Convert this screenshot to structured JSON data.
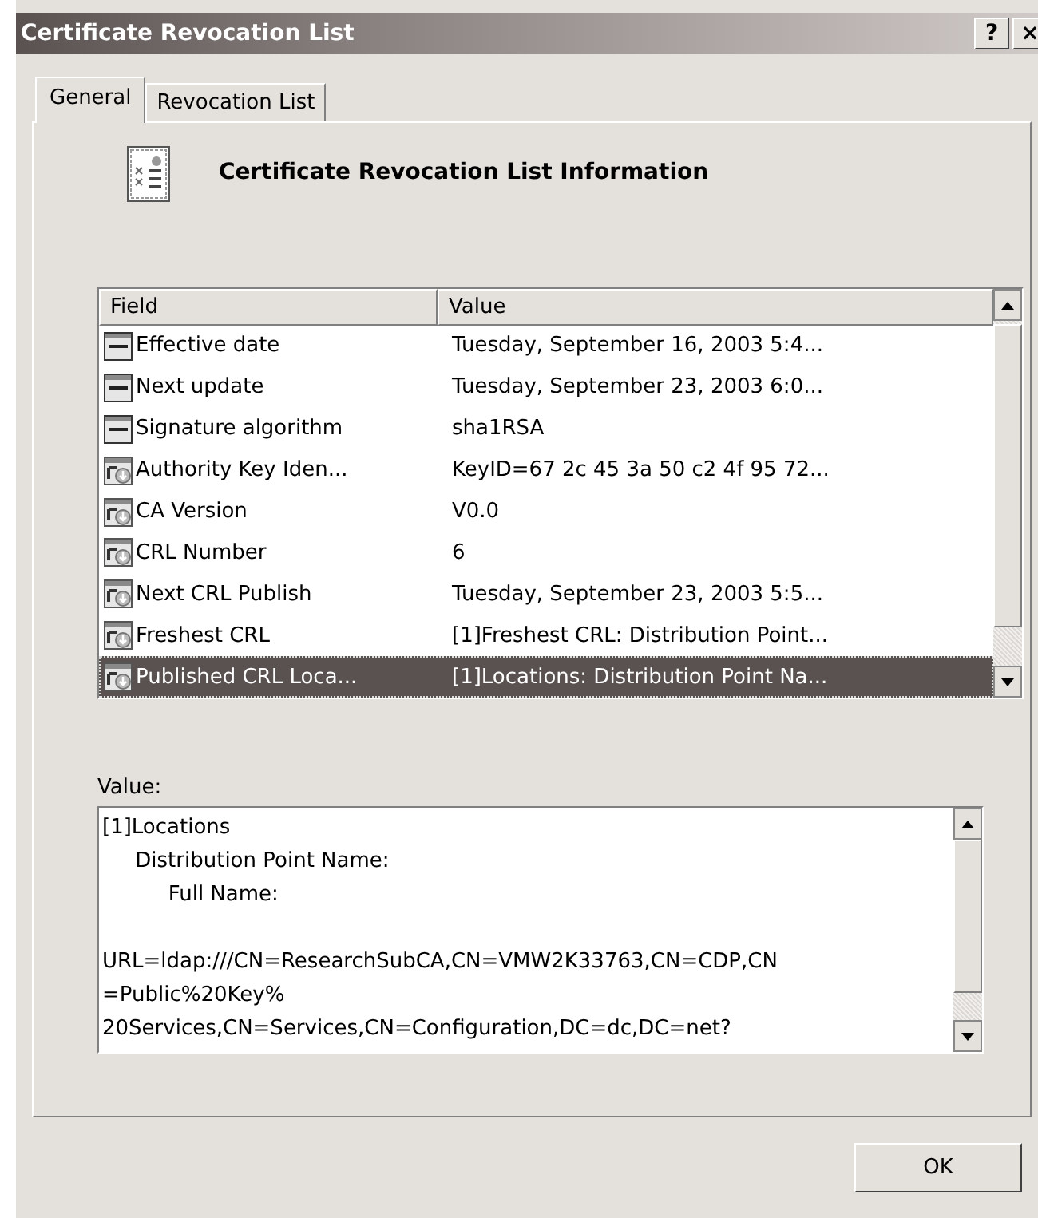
{
  "window": {
    "title": "Certificate Revocation List",
    "help_button": "?",
    "close_button": "×"
  },
  "tabs": [
    {
      "label": "General",
      "selected": true
    },
    {
      "label": "Revocation List",
      "selected": false
    }
  ],
  "heading": "Certificate Revocation List Information",
  "table": {
    "columns": [
      "Field",
      "Value"
    ],
    "rows": [
      {
        "kind": "simple",
        "field": "Effective date",
        "value": "Tuesday, September 16, 2003 5:4...",
        "selected": false
      },
      {
        "kind": "simple",
        "field": "Next update",
        "value": "Tuesday, September 23, 2003 6:0...",
        "selected": false
      },
      {
        "kind": "simple",
        "field": "Signature algorithm",
        "value": "sha1RSA",
        "selected": false
      },
      {
        "kind": "extension",
        "field": "Authority Key Iden...",
        "value": "KeyID=67 2c 45 3a 50 c2 4f 95 72...",
        "selected": false
      },
      {
        "kind": "extension",
        "field": "CA Version",
        "value": "V0.0",
        "selected": false
      },
      {
        "kind": "extension",
        "field": "CRL Number",
        "value": "6",
        "selected": false
      },
      {
        "kind": "extension",
        "field": "Next CRL Publish",
        "value": "Tuesday, September 23, 2003 5:5...",
        "selected": false
      },
      {
        "kind": "extension",
        "field": "Freshest CRL",
        "value": "[1]Freshest CRL: Distribution Point...",
        "selected": false
      },
      {
        "kind": "extension",
        "field": "Published CRL Loca...",
        "value": "[1]Locations: Distribution Point Na...",
        "selected": true
      }
    ]
  },
  "value_label": "Value:",
  "value_text": "[1]Locations\n     Distribution Point Name:\n          Full Name:\n\nURL=ldap:///CN=ResearchSubCA,CN=VMW2K33763,CN=CDP,CN\n=Public%20Key%\n20Services,CN=Services,CN=Configuration,DC=dc,DC=net?",
  "buttons": [
    "OK"
  ]
}
